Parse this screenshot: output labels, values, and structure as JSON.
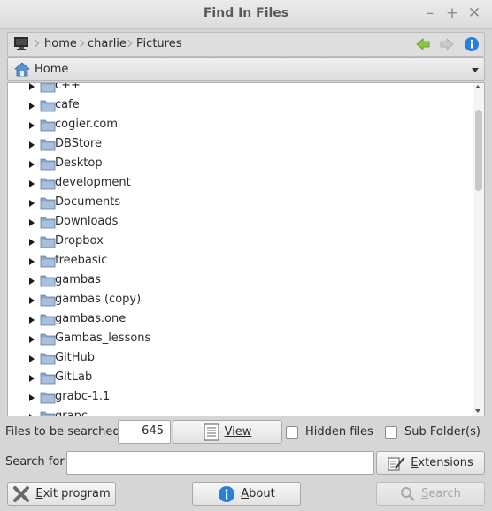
{
  "window": {
    "title": "Find In Files"
  },
  "pathbar": {
    "crumbs": [
      "home",
      "charlie",
      "Pictures"
    ]
  },
  "combo": {
    "value": "Home"
  },
  "tree": {
    "items": [
      "c++",
      "cafe",
      "cogier.com",
      "DBStore",
      "Desktop",
      "development",
      "Documents",
      "Downloads",
      "Dropbox",
      "freebasic",
      "gambas",
      "gambas (copy)",
      "gambas.one",
      "Gambas_lessons",
      "GitHub",
      "GitLab",
      "grabc-1.1",
      "grapc"
    ]
  },
  "controls": {
    "files_label": "Files to be searched",
    "files_count": "645",
    "view_label": "View",
    "hidden_files_label": "Hidden files",
    "sub_folders_label": "Sub Folder(s)",
    "search_for_label": "Search for",
    "search_value": "",
    "extensions_label": "Extensions",
    "exit_label": "Exit program",
    "about_label": "About",
    "search_button_label": "Search"
  },
  "icons": {
    "computer": "computer-icon",
    "back": "back-arrow-icon",
    "forward": "forward-arrow-icon",
    "info": "info-icon",
    "home": "home-icon",
    "folder": "folder-icon"
  },
  "colors": {
    "folder": "#8aa6c8",
    "back_arrow": "#8cc63f",
    "info": "#2a7fd4"
  }
}
